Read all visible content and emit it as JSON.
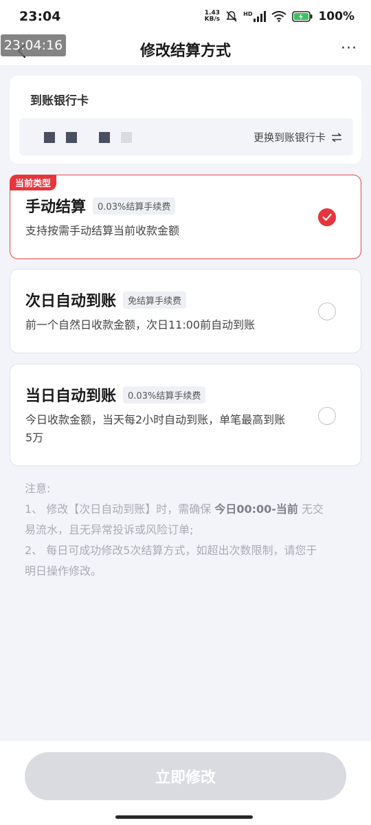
{
  "status_bar": {
    "time": "23:04",
    "net_speed_value": "1.43",
    "net_speed_unit": "KB/s",
    "hd_label": "HD",
    "battery": "100%"
  },
  "overlay_time": "23:04:16",
  "nav": {
    "title": "修改结算方式",
    "more": "···"
  },
  "bank": {
    "title": "到账银行卡",
    "change_label": "更换到账银行卡"
  },
  "options": [
    {
      "badge": "当前类型",
      "title": "手动结算",
      "fee": "0.03%结算手续费",
      "desc": "支持按需手动结算当前收款金额",
      "selected": true
    },
    {
      "title": "次日自动到账",
      "fee": "免结算手续费",
      "desc": "前一个自然日收款金额，次日11:00前自动到账",
      "selected": false
    },
    {
      "title": "当日自动到账",
      "fee": "0.03%结算手续费",
      "desc_line1": "今日收款金额，当天每2小时自动到账，单笔最高到账",
      "desc_line2": "5万",
      "selected": false
    }
  ],
  "notes": {
    "heading": "注意:",
    "n1_prefix": "1、 修改【次日自动到账】时，需确保 ",
    "n1_strong": "今日00:00-当前",
    "n1_suffix_a": " 无交",
    "n1_suffix_b": "易流水，且无异常投诉或风险订单;",
    "n2_a": "2、 每日可成功修改5次结算方式，如超出次数限制，请您于",
    "n2_b": "明日操作修改。"
  },
  "submit_label": "立即修改",
  "colors": {
    "accent_red": "#e8343c",
    "background": "#f3f4f9",
    "button_disabled": "#d9dbe1"
  }
}
